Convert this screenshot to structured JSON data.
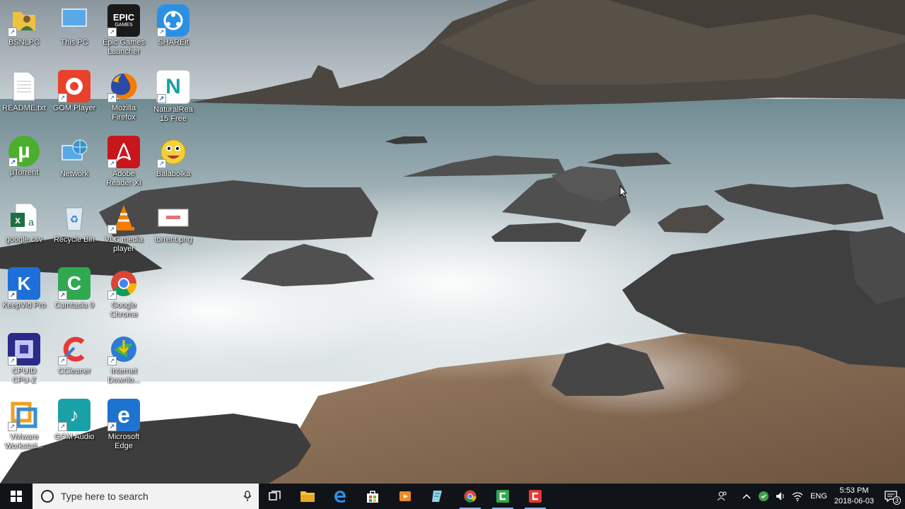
{
  "desktop": {
    "icons": [
      {
        "label": "BSNLPC"
      },
      {
        "label": "This PC"
      },
      {
        "label": "Epic Games Launcher",
        "glyph": "EPIC",
        "sub": "GAMES"
      },
      {
        "label": "SHAREit"
      },
      {
        "label": "README.txt"
      },
      {
        "label": "GOM Player"
      },
      {
        "label": "Mozilla Firefox"
      },
      {
        "label": "NaturalRea 15 Free",
        "glyph": "N"
      },
      {
        "label": "µTorrent",
        "glyph": "µ"
      },
      {
        "label": "Network"
      },
      {
        "label": "Adobe Reader XI"
      },
      {
        "label": "Balabolka"
      },
      {
        "label": "google.csv",
        "glyph": "x"
      },
      {
        "label": "Recycle Bin"
      },
      {
        "label": "VLC media player"
      },
      {
        "label": "torrent.png"
      },
      {
        "label": "KeepVid Pro",
        "glyph": "K"
      },
      {
        "label": "Camtasia 9",
        "glyph": "C"
      },
      {
        "label": "Google Chrome"
      },
      {
        "label": "CPUID CPU-Z"
      },
      {
        "label": "CCleaner"
      },
      {
        "label": "Internet Downlo..."
      },
      {
        "label": "VMware Workstati..."
      },
      {
        "label": "GOM Audio"
      },
      {
        "label": "Microsoft Edge",
        "glyph": "e"
      }
    ]
  },
  "taskbar": {
    "search_placeholder": "Type here to search",
    "pinned": [
      {
        "name": "task-view"
      },
      {
        "name": "file-explorer"
      },
      {
        "name": "edge"
      },
      {
        "name": "store"
      },
      {
        "name": "media-app"
      },
      {
        "name": "notes"
      },
      {
        "name": "chrome"
      },
      {
        "name": "camtasia-green"
      },
      {
        "name": "camtasia-red"
      }
    ],
    "tray": {
      "language": "ENG",
      "time": "5:53 PM",
      "date": "2018-06-03",
      "notification_count": "3"
    }
  },
  "colors": {
    "taskbar_bg": "#101418",
    "search_bg": "#f2f2f2",
    "accent": "#0078d7"
  }
}
